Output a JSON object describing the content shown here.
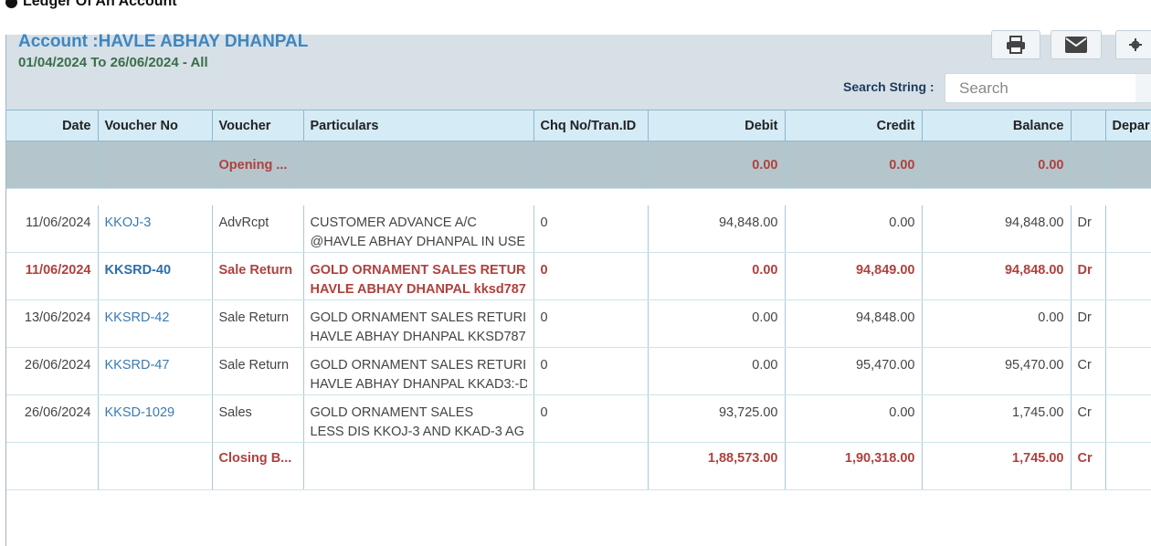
{
  "page_heading": "Ledger Of An Account",
  "account": {
    "title": "Account :HAVLE ABHAY DHANPAL",
    "range": "01/04/2024 To 26/06/2024 - All"
  },
  "toolbar": {
    "print_icon": "printer-icon",
    "email_icon": "envelope-icon",
    "settings_icon": "gear-icon"
  },
  "search": {
    "label": "Search String :",
    "placeholder": "Search",
    "value": ""
  },
  "table": {
    "columns": [
      "Date",
      "Voucher No",
      "Voucher",
      "Particulars",
      "Chq No/Tran.ID",
      "Debit",
      "Credit",
      "Balance",
      "",
      "Depar"
    ],
    "opening": {
      "voucher": "Opening ...",
      "debit": "0.00",
      "credit": "0.00",
      "balance": "0.00"
    },
    "rows": [
      {
        "date": "11/06/2024",
        "voucher_no": "KKOJ-3",
        "voucher": "AdvRcpt",
        "particulars_1": "CUSTOMER ADVANCE A/C",
        "particulars_2": "@HAVLE ABHAY DHANPAL IN USE",
        "chq": "0",
        "debit": "94,848.00",
        "credit": "0.00",
        "balance": "94,848.00",
        "drcr": "Dr"
      },
      {
        "date": "11/06/2024",
        "voucher_no": "KKSRD-40",
        "voucher": "Sale Return",
        "particulars_1": "GOLD ORNAMENT SALES RETUR",
        "particulars_2": "HAVLE ABHAY DHANPAL kksd787",
        "chq": "0",
        "debit": "0.00",
        "credit": "94,849.00",
        "balance": "94,848.00",
        "drcr": "Dr"
      },
      {
        "date": "13/06/2024",
        "voucher_no": "KKSRD-42",
        "voucher": "Sale Return",
        "particulars_1": "GOLD ORNAMENT SALES RETURI",
        "particulars_2": "HAVLE ABHAY DHANPAL KKSD787",
        "chq": "0",
        "debit": "0.00",
        "credit": "94,848.00",
        "balance": "0.00",
        "drcr": "Dr"
      },
      {
        "date": "26/06/2024",
        "voucher_no": "KKSRD-47",
        "voucher": "Sale Return",
        "particulars_1": "GOLD ORNAMENT SALES RETURI",
        "particulars_2": "HAVLE ABHAY DHANPAL KKAD3:-D",
        "chq": "0",
        "debit": "0.00",
        "credit": "95,470.00",
        "balance": "95,470.00",
        "drcr": "Cr"
      },
      {
        "date": "26/06/2024",
        "voucher_no": "KKSD-1029",
        "voucher": "Sales",
        "particulars_1": "GOLD ORNAMENT SALES",
        "particulars_2": "LESS DIS KKOJ-3 AND KKAD-3 AG",
        "chq": "0",
        "debit": "93,725.00",
        "credit": "0.00",
        "balance": "1,745.00",
        "drcr": "Cr"
      }
    ],
    "closing": {
      "voucher": "Closing B...",
      "debit": "1,88,573.00",
      "credit": "1,90,318.00",
      "balance": "1,745.00",
      "drcr": "Cr"
    }
  },
  "colors": {
    "header_bg": "#d6e0e6",
    "table_header_bg": "#d5ebf6",
    "opening_bg": "#b4c6cb",
    "accent_red": "#b0413e",
    "link_blue": "#3a7ab3"
  }
}
